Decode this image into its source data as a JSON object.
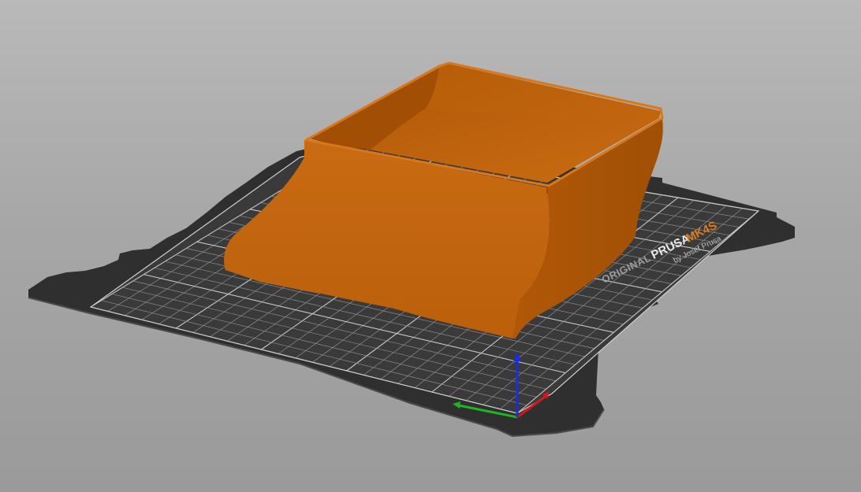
{
  "viewport": {
    "name": "3D Preview",
    "background_top": "#b9b9b9",
    "background_bottom": "#9a9a9a"
  },
  "bed": {
    "brand_prefix": "ORIGINAL",
    "brand": "PRUSA",
    "model": "MK4S",
    "byline": "by Josef Prusa",
    "sheet_color": "#2f2f2f",
    "grid_color": "#9a9a9a"
  },
  "model_object": {
    "color": "#c8680d"
  },
  "axes": {
    "x_color": "#d11a1a",
    "y_color": "#1fb51f",
    "z_color": "#1a2ed6"
  }
}
